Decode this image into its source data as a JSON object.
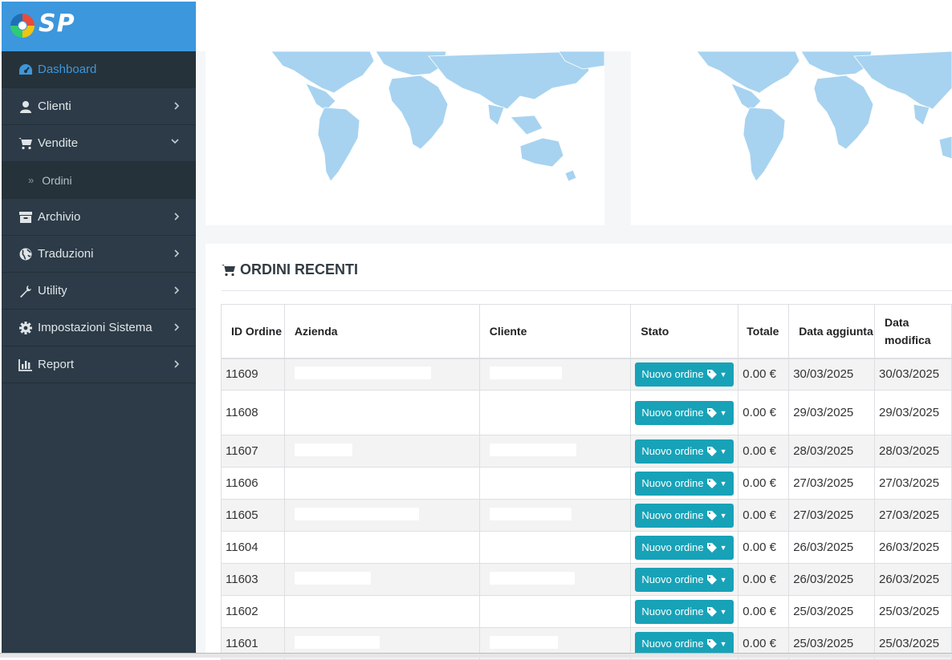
{
  "brand": {
    "logo_text": "SP"
  },
  "sidebar": {
    "items": [
      {
        "label": "Dashboard",
        "icon": "dashboard-icon",
        "active": true
      },
      {
        "label": "Clienti",
        "icon": "user-icon"
      },
      {
        "label": "Vendite",
        "icon": "cart-icon",
        "expanded": true
      },
      {
        "label": "Ordini",
        "icon": "double-chevron-right-icon",
        "sub": true
      },
      {
        "label": "Archivio",
        "icon": "archive-icon"
      },
      {
        "label": "Traduzioni",
        "icon": "globe-icon"
      },
      {
        "label": "Utility",
        "icon": "wrench-icon"
      },
      {
        "label": "Impostazioni Sistema",
        "icon": "gear-icon"
      },
      {
        "label": "Report",
        "icon": "bar-chart-icon"
      }
    ]
  },
  "orders": {
    "title": "ORDINI RECENTI",
    "columns": [
      "ID Ordine",
      "Azienda",
      "Cliente",
      "Stato",
      "Totale",
      "Data aggiunta",
      "Data modifica"
    ],
    "status_label": "Nuovo ordine",
    "rows": [
      {
        "id": "11609",
        "totale": "0.00 €",
        "aggiunta": "30/03/2025",
        "modifica": "30/03/2025"
      },
      {
        "id": "11608",
        "totale": "0.00 €",
        "aggiunta": "29/03/2025",
        "modifica": "29/03/2025"
      },
      {
        "id": "11607",
        "totale": "0.00 €",
        "aggiunta": "28/03/2025",
        "modifica": "28/03/2025"
      },
      {
        "id": "11606",
        "totale": "0.00 €",
        "aggiunta": "27/03/2025",
        "modifica": "27/03/2025"
      },
      {
        "id": "11605",
        "totale": "0.00 €",
        "aggiunta": "27/03/2025",
        "modifica": "27/03/2025"
      },
      {
        "id": "11604",
        "totale": "0.00 €",
        "aggiunta": "26/03/2025",
        "modifica": "26/03/2025"
      },
      {
        "id": "11603",
        "totale": "0.00 €",
        "aggiunta": "26/03/2025",
        "modifica": "26/03/2025"
      },
      {
        "id": "11602",
        "totale": "0.00 €",
        "aggiunta": "25/03/2025",
        "modifica": "25/03/2025"
      },
      {
        "id": "11601",
        "totale": "0.00 €",
        "aggiunta": "25/03/2025",
        "modifica": "25/03/2025"
      }
    ]
  },
  "colors": {
    "sidebar_bg": "#2c3b47",
    "logo_bar": "#3c97dd",
    "active_text": "#3c97dd",
    "status_button": "#17a2b8",
    "map_land": "#a7d3f0"
  }
}
